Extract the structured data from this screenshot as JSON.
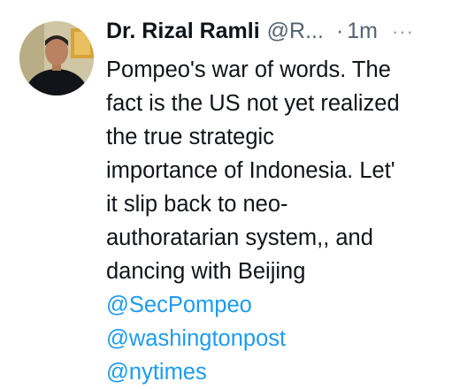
{
  "tweet": {
    "author_name": "Dr. Rizal Ramli",
    "author_handle": "@R...",
    "separator": "·",
    "time": "1m",
    "more_label": "···",
    "text": "Pompeo's war of words. The\nfact is the US not yet realized\nthe true strategic\nimportance of Indonesia. Let'\nit slip back to neo-\nauthoratarian system,, and\ndancing with Beijing",
    "mentions": [
      "@SecPompeo",
      "@washingtonpost",
      "@nytimes"
    ],
    "avatar_icon": "profile-photo"
  },
  "colors": {
    "text": "#0f1419",
    "muted": "#536471",
    "link": "#1d9bf0"
  }
}
